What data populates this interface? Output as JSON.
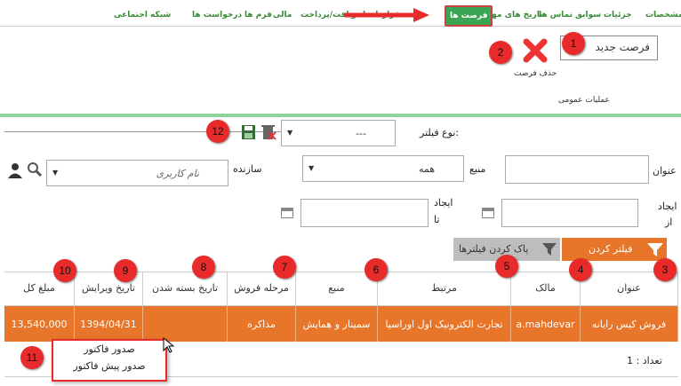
{
  "tabs": [
    {
      "label": "مشخصات",
      "active": false
    },
    {
      "label": "جزئیات",
      "active": false
    },
    {
      "label": "سوابق",
      "active": false
    },
    {
      "label": "تماس ها",
      "active": false
    },
    {
      "label": "تاریخ های مهم",
      "active": false
    },
    {
      "label": "فرصت ها",
      "active": true
    },
    {
      "label": "قراردادها",
      "active": false
    },
    {
      "label": "دریافت/پرداخت",
      "active": false
    },
    {
      "label": "مالی",
      "active": false
    },
    {
      "label": "فرم ها",
      "active": false
    },
    {
      "label": "درخواست ها",
      "active": false
    },
    {
      "label": "شبکه اجتماعی",
      "active": false
    }
  ],
  "toolbar": {
    "new_label": "فرصت جدید",
    "delete_label": "حذف فرصت",
    "group_label": "عملیات عمومی"
  },
  "filter": {
    "type_label": "نوع فیلتر:",
    "type_value": "---",
    "title_label": "عنوان",
    "source_label": "منبع",
    "source_value": "همه",
    "creator_label": "سازنده",
    "creator_placeholder": "نام کاربری",
    "created_from_label": "ایجاد",
    "from_label": "از",
    "created_to_label": "ایجاد",
    "to_label": "تا",
    "apply_label": "فیلتر کردن",
    "clear_label": "پاک کردن فیلترها"
  },
  "table": {
    "headers": [
      "عنوان",
      "مالک",
      "مرتبط",
      "منبع",
      "مرحله فروش",
      "تاریخ بسته شدن",
      "تاریخ ویرایش",
      "مبلغ کل"
    ],
    "row": [
      "فروش کیس رایانه",
      "a.mahdevar",
      "تجارت الکترونیک اول اوراسیا",
      "سمینار و همایش",
      "مذاکره",
      "",
      "1394/04/31",
      "13,540,000"
    ],
    "count_label": "تعداد : 1"
  },
  "context_menu": [
    "صدور فاکتور",
    "صدور پیش فاکتور"
  ],
  "badges": [
    "1",
    "2",
    "3",
    "4",
    "5",
    "6",
    "7",
    "8",
    "9",
    "10",
    "11",
    "12"
  ],
  "colors": {
    "accent": "#e8762a",
    "green": "#3aa655",
    "badge": "#e82a2a"
  }
}
